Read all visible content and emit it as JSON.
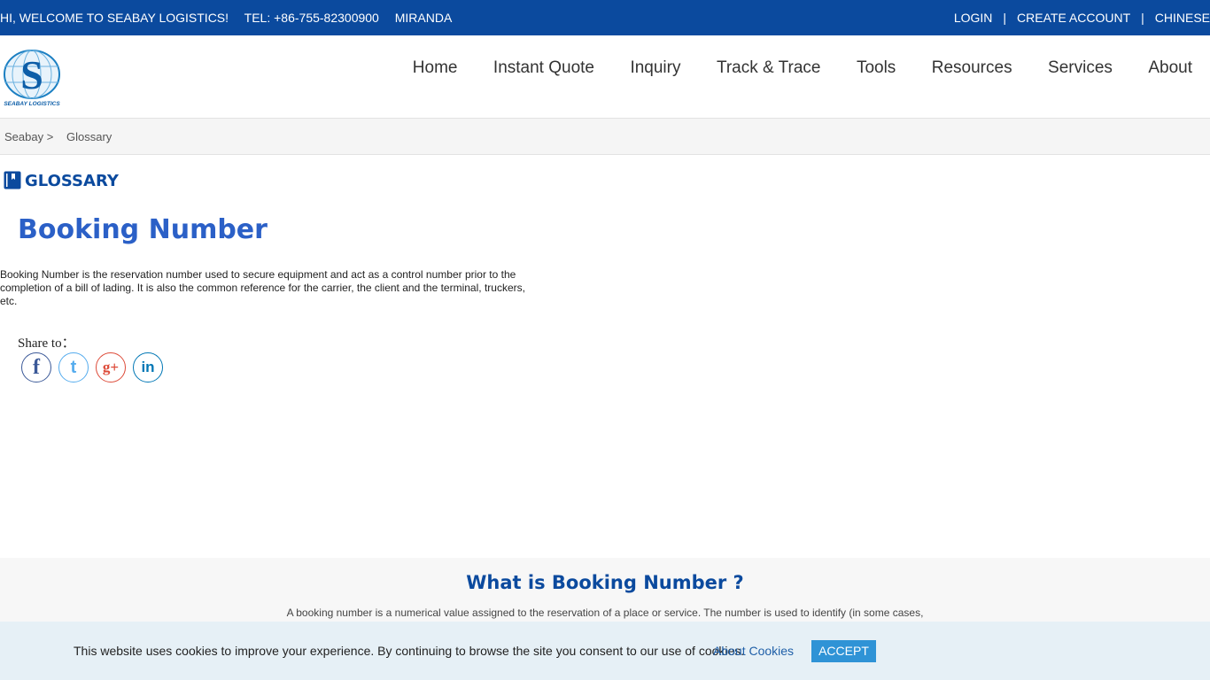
{
  "topbar": {
    "welcome": "HI, WELCOME TO  SEABAY  LOGISTICS!",
    "tel": "TEL: +86-755-82300900",
    "contact": "MIRANDA",
    "login": "LOGIN",
    "create_account": "CREATE ACCOUNT",
    "language": "CHINESE",
    "separator": "|"
  },
  "logo": {
    "text": "SEABAY LOGISTICS",
    "icon": "seabay-logo"
  },
  "nav": {
    "items": [
      {
        "label": "Home"
      },
      {
        "label": "Instant Quote"
      },
      {
        "label": "Inquiry"
      },
      {
        "label": "Track & Trace"
      },
      {
        "label": "Tools"
      },
      {
        "label": "Resources"
      },
      {
        "label": "Services"
      },
      {
        "label": "About"
      }
    ]
  },
  "breadcrumb": {
    "home": "Seabay >",
    "current": "Glossary"
  },
  "glossary": {
    "heading": "GLOSSARY",
    "icon": "book-icon",
    "term": "Booking Number",
    "description": "Booking Number is the reservation number used to secure equipment and act as a control number prior to the completion of a bill of lading. It is also the common reference for the carrier, the client and the terminal, truckers, etc."
  },
  "share": {
    "label": "Share to：",
    "icons": [
      {
        "name": "facebook-icon",
        "glyph": "f",
        "color": "#3b5998"
      },
      {
        "name": "twitter-icon",
        "glyph": "t",
        "color": "#55acee"
      },
      {
        "name": "google-plus-icon",
        "glyph": "g+",
        "color": "#dd4b39"
      },
      {
        "name": "linkedin-icon",
        "glyph": "in",
        "color": "#0077b5"
      }
    ]
  },
  "what": {
    "title": "What is Booking Number ?",
    "text": "A booking number is a numerical value assigned to the reservation of a place or service. The number is used to identify (in some cases,"
  },
  "cookie": {
    "message": "This website uses cookies to improve your experience. By continuing to browse the site you consent to our use of cookies.",
    "about_label": "About Cookies",
    "accept_label": "ACCEPT"
  },
  "colors": {
    "brand": "#0b4a9e",
    "title": "#2b60c7",
    "accept": "#2f93d6"
  }
}
